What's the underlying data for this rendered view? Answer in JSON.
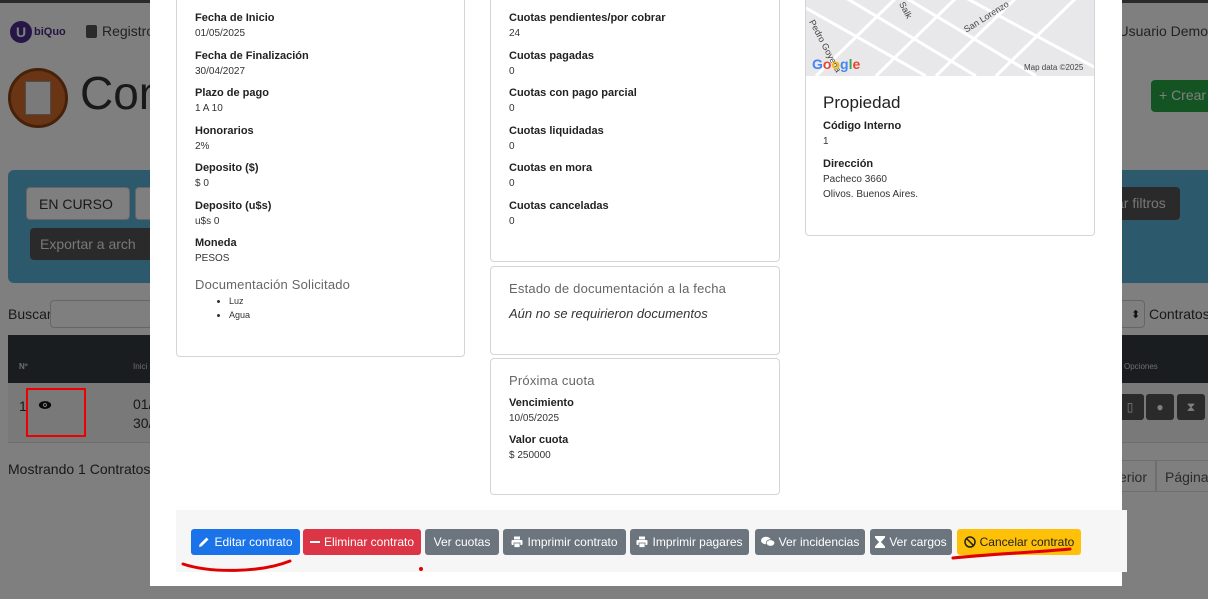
{
  "background": {
    "brand": "biQuo",
    "brand_letter": "U",
    "nav_registro": "Registro",
    "nav_user": "Usuario Demo",
    "page_title": "Con",
    "crear_button": "+ Crear",
    "estado_filter": "EN CURSO",
    "export_button": "Exportar a arch",
    "filtros_button": "ar filtros",
    "search_label": "Buscar",
    "contratos_label": "Contratos",
    "table": {
      "col_n": "Nº",
      "col_inicio": "Inici",
      "col_opciones": "Opciones",
      "row": {
        "n": "1",
        "date1": "01/",
        "date2": "30/"
      }
    },
    "mostrando": "Mostrando 1 Contratos",
    "pagination": {
      "prev": "erior",
      "page": "Página"
    }
  },
  "modal": {
    "left_card": {
      "fields": [
        {
          "label": "Fecha de Inicio",
          "value": "01/05/2025"
        },
        {
          "label": "Fecha de Finalización",
          "value": "30/04/2027"
        },
        {
          "label": "Plazo de pago",
          "value": "1 A 10"
        },
        {
          "label": "Honorarios",
          "value": "2%"
        },
        {
          "label": "Deposito ($)",
          "value": "$ 0"
        },
        {
          "label": "Deposito (u$s)",
          "value": "u$s 0"
        },
        {
          "label": "Moneda",
          "value": "PESOS"
        }
      ],
      "doc_title": "Documentación Solicitado",
      "doc_items": [
        "Luz",
        "Agua"
      ]
    },
    "mid_card": {
      "fields": [
        {
          "label": "Cuotas pendientes/por cobrar",
          "value": "24"
        },
        {
          "label": "Cuotas pagadas",
          "value": "0"
        },
        {
          "label": "Cuotas con pago parcial",
          "value": "0"
        },
        {
          "label": "Cuotas liquidadas",
          "value": "0"
        },
        {
          "label": "Cuotas en mora",
          "value": "0"
        },
        {
          "label": "Cuotas canceladas",
          "value": "0"
        }
      ]
    },
    "doc_state_card": {
      "title": "Estado de documentación a la fecha",
      "text": "Aún no se requirieron documentos"
    },
    "next_card": {
      "title": "Próxima cuota",
      "vencimiento_label": "Vencimiento",
      "vencimiento_value": "10/05/2025",
      "valor_label": "Valor cuota",
      "valor_value": "$ 250000"
    },
    "map": {
      "streets": [
        "Pedro Goyena",
        "Salk",
        "San Lorenzo"
      ],
      "google": "Google",
      "map_data": "Map data ©2025"
    },
    "property_card": {
      "title": "Propiedad",
      "codigo_label": "Código Interno",
      "codigo_value": "1",
      "direccion_label": "Dirección",
      "direccion_line1": "Pacheco 3660",
      "direccion_line2": "Olivos. Buenos Aires."
    },
    "buttons": {
      "edit": "Editar contrato",
      "delete": "Eliminar contrato",
      "cuotas": "Ver cuotas",
      "print_contract": "Imprimir contrato",
      "print_pagares": "Imprimir pagares",
      "incidencias": "Ver incidencias",
      "cargos": "Ver cargos",
      "cancel": "Cancelar contrato"
    }
  },
  "colors": {
    "primary": "#1a73e8",
    "danger": "#dc3545",
    "secondary": "#6c757d",
    "warning": "#ffc107",
    "annotation_red": "#e00000"
  }
}
